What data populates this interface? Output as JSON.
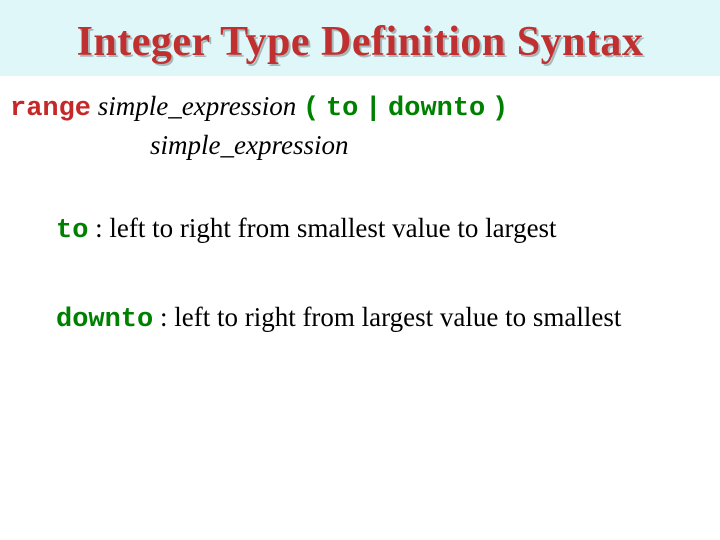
{
  "title": "Integer Type Definition Syntax",
  "syntax": {
    "range_kw": "range",
    "expr": "simple_expression",
    "open": "(",
    "to_kw": "to",
    "bar": "|",
    "downto_kw": "downto",
    "close": ")"
  },
  "defs": {
    "to_kw": "to",
    "to_text": " :  left to right from smallest value to largest",
    "downto_kw": "downto",
    "downto_text": " :  left to right from largest value to smallest"
  }
}
